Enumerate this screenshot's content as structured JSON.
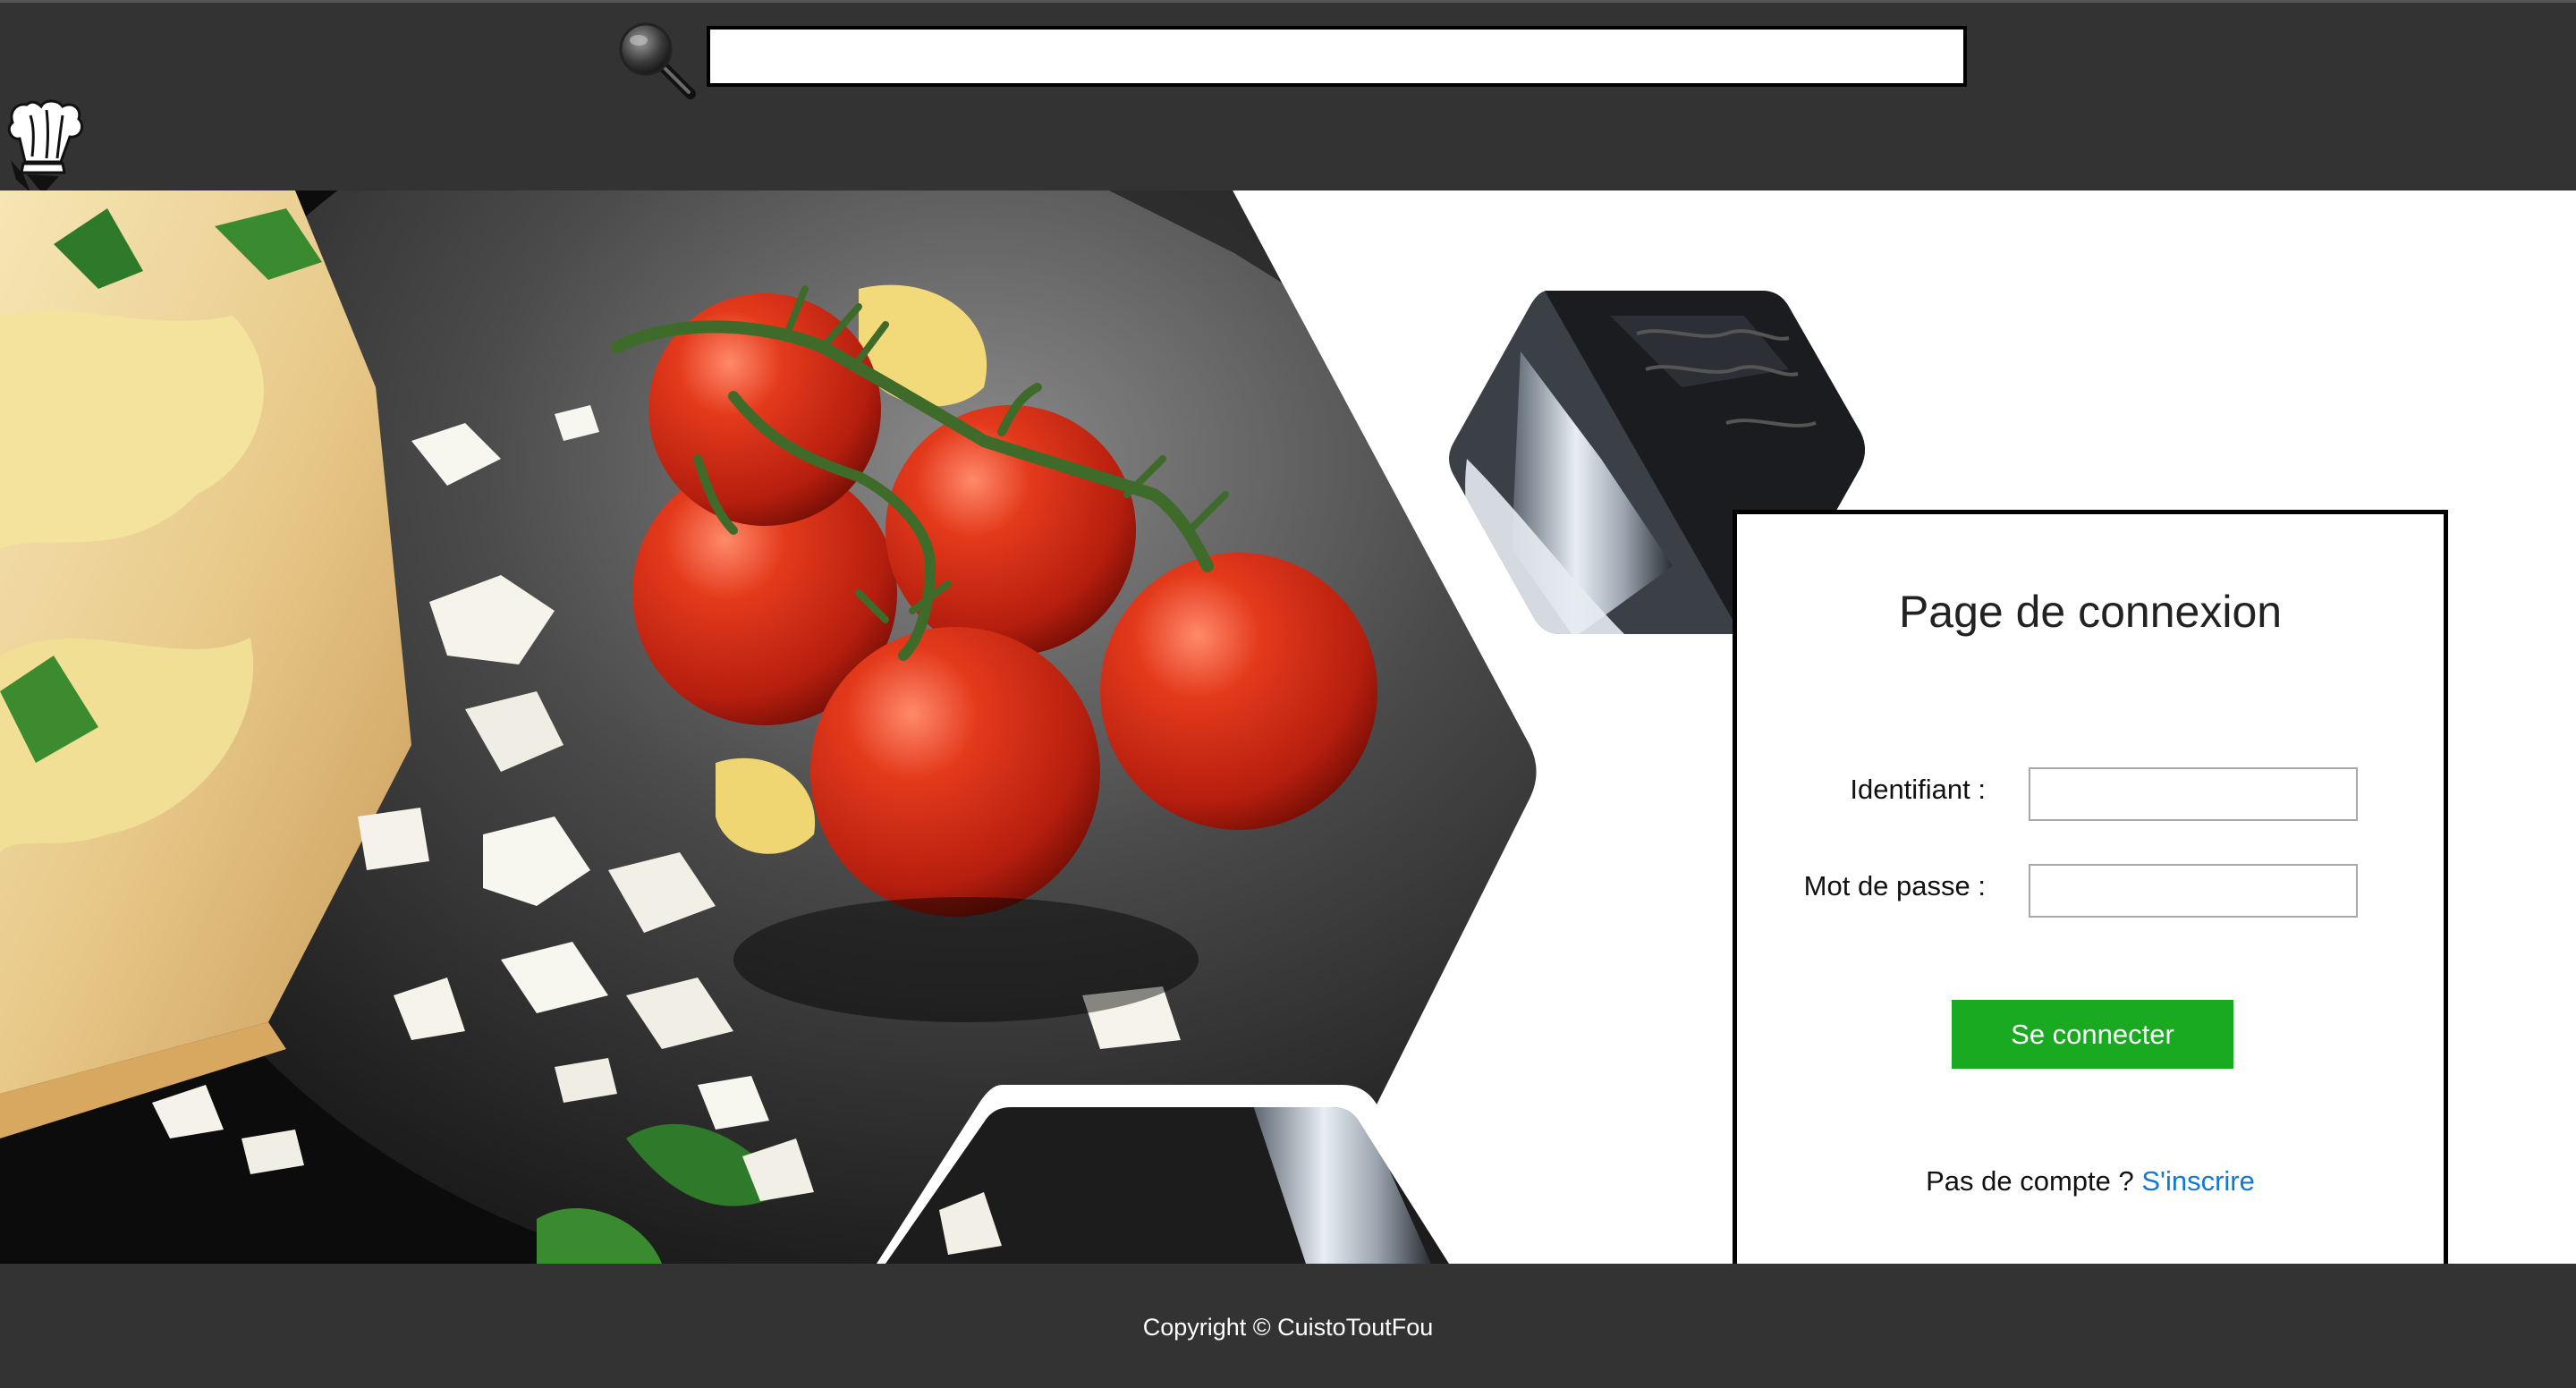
{
  "header": {
    "search": {
      "placeholder": "",
      "value": "",
      "icon": "search-icon"
    },
    "logo_icon": "chef-hat-icon"
  },
  "hero": {
    "image": "tomatoes-plate-photo"
  },
  "login": {
    "title": "Page de connexion",
    "username_label": "Identifiant :",
    "username_value": "",
    "password_label": "Mot de passe :",
    "password_value": "",
    "submit_label": "Se connecter",
    "no_account_text": "Pas de compte ?",
    "signup_link": "S'inscrire"
  },
  "footer": {
    "copyright": "Copyright © CuistoToutFou"
  },
  "colors": {
    "header_bg": "#333333",
    "footer_bg": "#333333",
    "button_green": "#1aaa22",
    "link_blue": "#1278d8"
  }
}
